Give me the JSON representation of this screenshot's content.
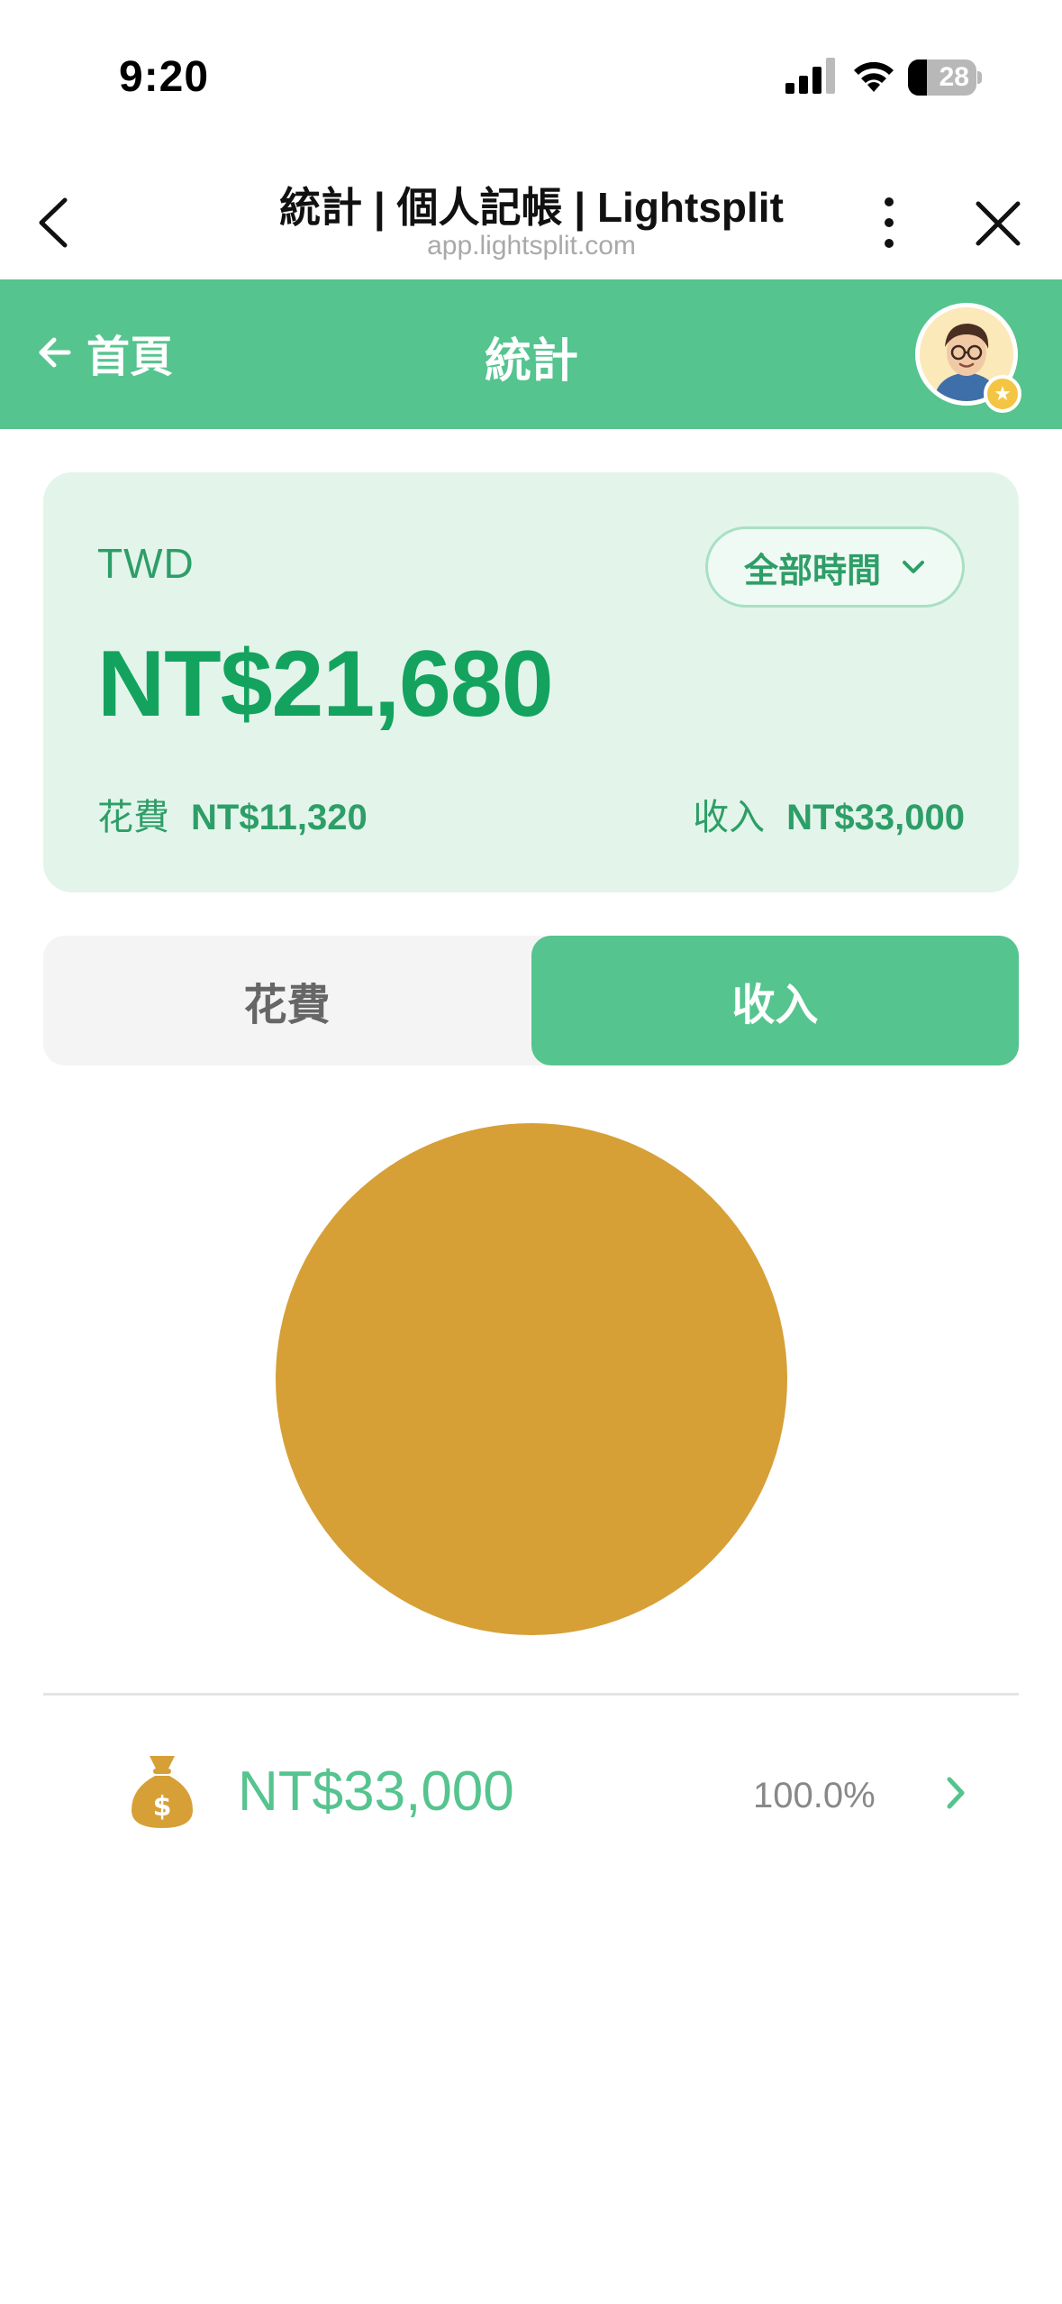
{
  "status_bar": {
    "time": "9:20",
    "battery_level": "28",
    "battery_fraction": 0.28
  },
  "browser": {
    "title": "統計 | 個人記帳 | Lightsplit",
    "url": "app.lightsplit.com",
    "icons": [
      "back-chevron-icon",
      "more-vertical-icon",
      "close-icon"
    ]
  },
  "app_header": {
    "home_label": "首頁",
    "title": "統計",
    "accent_color": "#55c48e"
  },
  "summary": {
    "currency": "TWD",
    "range_label": "全部時間",
    "balance": "NT$21,680",
    "expense_label": "花費",
    "expense_value": "NT$11,320",
    "income_label": "收入",
    "income_value": "NT$33,000"
  },
  "tabs": {
    "expense": "花費",
    "income": "收入",
    "selected": "income"
  },
  "chart_data": {
    "type": "pie",
    "slices": [
      {
        "value": 33000,
        "percent": 100.0,
        "color": "#d6a037",
        "icon": "money-bag-icon"
      }
    ]
  },
  "categories": [
    {
      "icon": "money-bag-icon",
      "amount": "NT$33,000",
      "percent": "100.0%",
      "color": "#d6a037"
    }
  ]
}
